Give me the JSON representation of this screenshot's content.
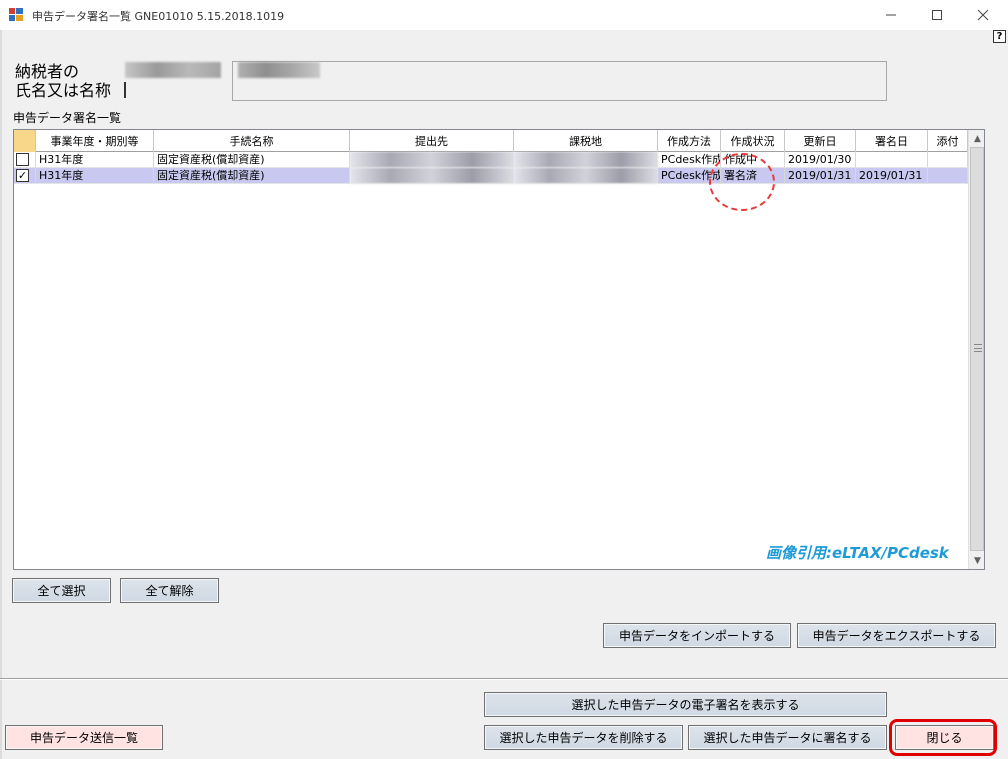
{
  "window": {
    "title": "申告データ署名一覧 GNE01010  5.15.2018.1019",
    "minimize_icon": "minimize-icon",
    "maximize_icon": "maximize-icon",
    "close_icon": "close-icon",
    "help_glyph": "?"
  },
  "taxpayer": {
    "label_line1": "納税者の",
    "label_line2": "氏名又は名称"
  },
  "list": {
    "section_label": "申告データ署名一覧",
    "columns": [
      "",
      "事業年度・期別等",
      "手続名称",
      "提出先",
      "課税地",
      "作成方法",
      "作成状況",
      "更新日",
      "署名日",
      "添付"
    ],
    "rows": [
      {
        "checked": false,
        "check_glyph": "",
        "period": "H31年度",
        "procedure": "固定資産税(償却資産)",
        "method": "PCdesk作成",
        "status": "作成中",
        "updated": "2019/01/30",
        "signed": "",
        "attach": ""
      },
      {
        "checked": true,
        "check_glyph": "✓",
        "period": "H31年度",
        "procedure": "固定資産税(償却資産)",
        "method": "PCdesk作成",
        "status": "署名済",
        "updated": "2019/01/31",
        "signed": "2019/01/31",
        "attach": ""
      }
    ],
    "watermark": "画像引用:eLTAX/PCdesk"
  },
  "buttons": {
    "select_all": "全て選択",
    "deselect_all": "全て解除",
    "import": "申告データをインポートする",
    "export": "申告データをエクスポートする",
    "show_signature": "選択した申告データの電子署名を表示する",
    "send_list": "申告データ送信一覧",
    "delete": "選択した申告データを削除する",
    "sign": "選択した申告データに署名する",
    "close": "閉じる"
  }
}
